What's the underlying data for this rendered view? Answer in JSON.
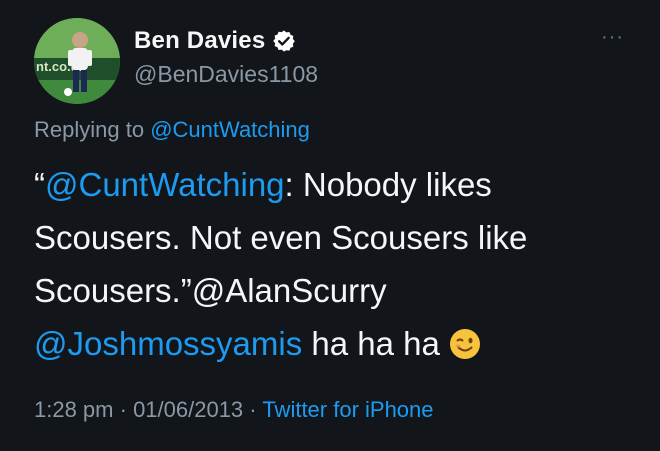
{
  "author": {
    "name": "Ben Davies",
    "handle": "@BenDavies1108",
    "avatar_text": "nt.co.uk"
  },
  "more_glyph": "···",
  "reply": {
    "prefix": "Replying to ",
    "to": "@CuntWatching"
  },
  "tweet": {
    "quote_open": "“",
    "mention1": "@CuntWatching",
    "line1_rest": ": Nobody likes",
    "line2": "Scousers. Not even Scousers like",
    "line3": "Scousers.”@AlanScurry",
    "mention2": "@Joshmossyamis",
    "line4_rest": " ha ha ha ",
    "emoji": "winking-face"
  },
  "meta": {
    "time": "1:28 pm",
    "sep1": " · ",
    "date": "01/06/2013",
    "sep2": " · ",
    "source": "Twitter for iPhone"
  },
  "colors": {
    "background": "#121519",
    "link": "#1d9bf0",
    "secondary_text": "#8b98a5",
    "verified": "#ffffff"
  }
}
